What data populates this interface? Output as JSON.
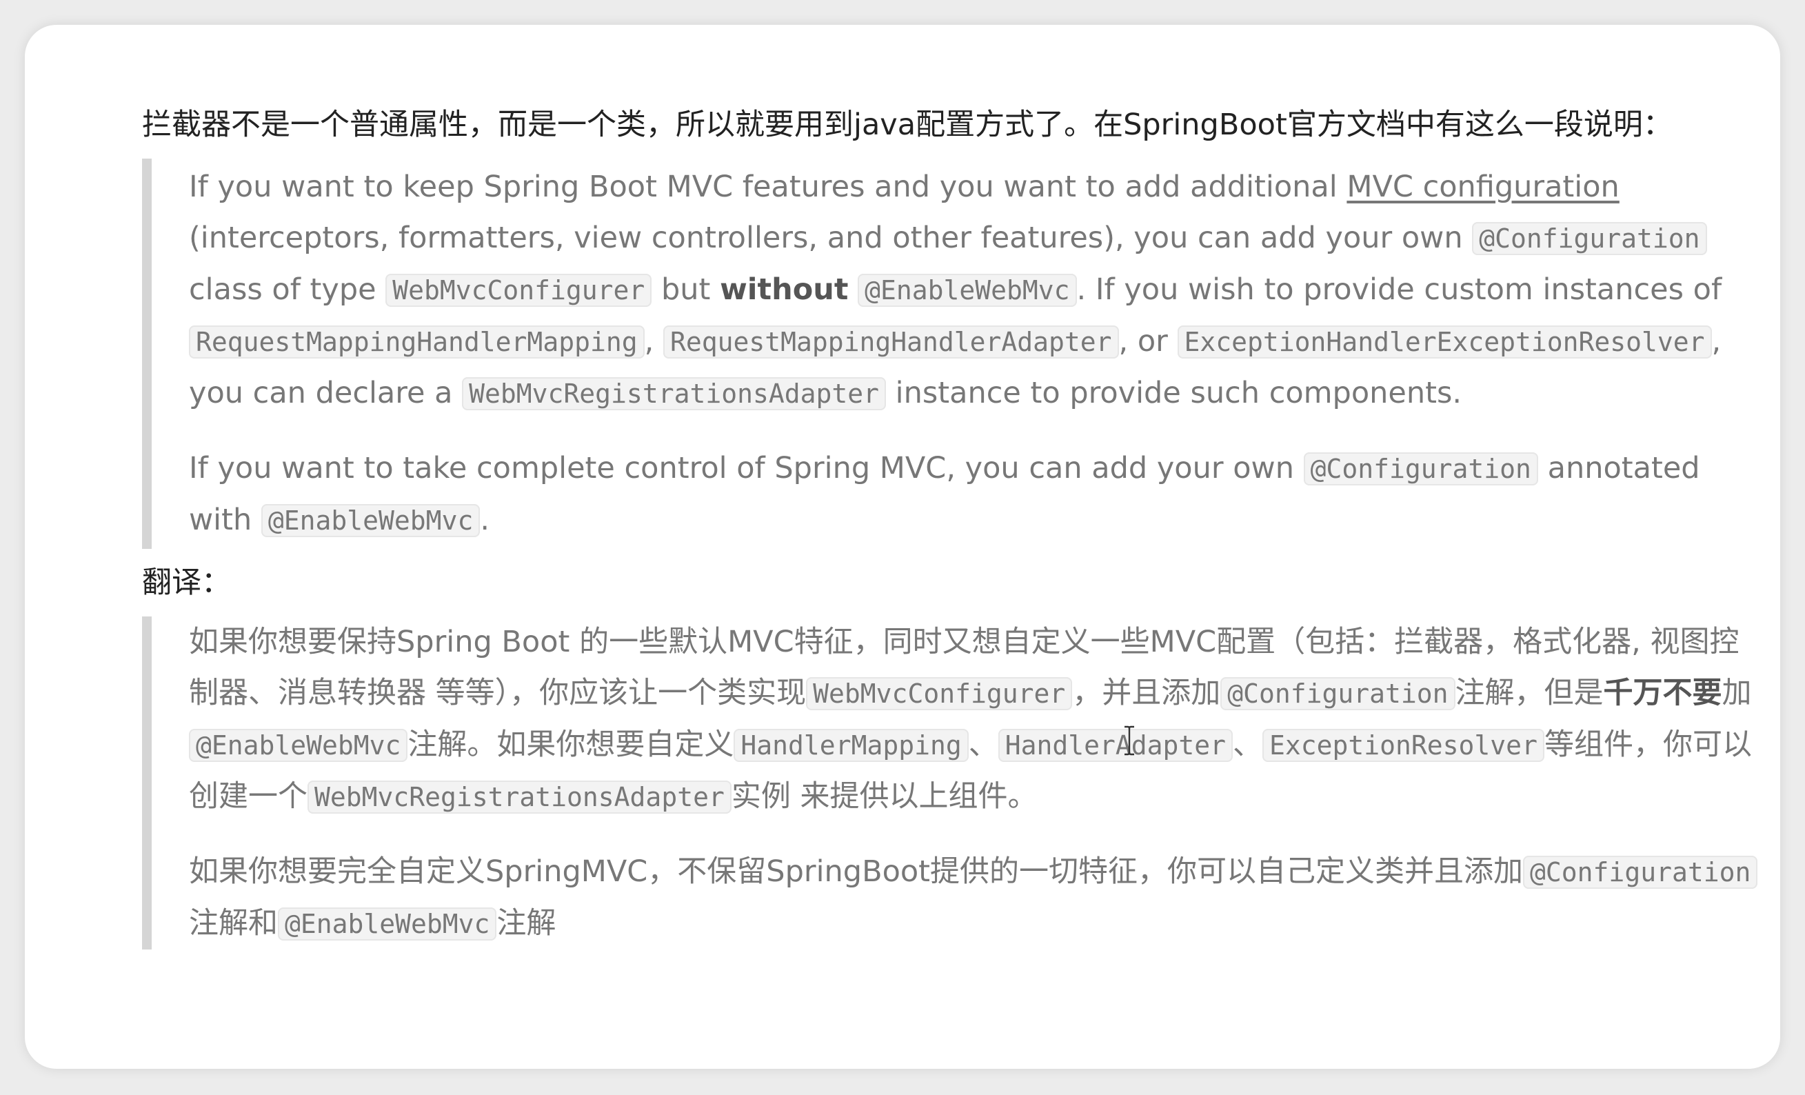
{
  "intro": {
    "text": "拦截器不是一个普通属性，而是一个类，所以就要用到java配置方式了。在SpringBoot官方文档中有这么一段说明："
  },
  "quote_en": {
    "p1": {
      "t1": "If you want to keep Spring Boot MVC features and you want to add additional ",
      "link": "MVC configuration",
      "t2": " (interceptors, formatters, view controllers, and other features), you can add your own ",
      "c1": "@Configuration",
      "t3": " class of type ",
      "c2": "WebMvcConfigurer",
      "t4": " but ",
      "bold": "without",
      "t5": " ",
      "c3": "@EnableWebMvc",
      "t6": ". If you wish to provide custom instances of ",
      "c4": "RequestMappingHandlerMapping",
      "t7": ", ",
      "c5": "RequestMappingHandlerAdapter",
      "t8": ", or ",
      "c6": "ExceptionHandlerExceptionResolver",
      "t9": ", you can declare a ",
      "c7": "WebMvcRegistrationsAdapter",
      "t10": " instance to provide such components."
    },
    "p2": {
      "t1": "If you want to take complete control of Spring MVC, you can add your own ",
      "c1": "@Configuration",
      "t2": " annotated with ",
      "c2": "@EnableWebMvc",
      "t3": "."
    }
  },
  "translate_label": "翻译：",
  "quote_zh": {
    "p1": {
      "t1": "如果你想要保持Spring Boot 的一些默认MVC特征，同时又想自定义一些MVC配置（包括：拦截器，格式化器, 视图控制器、消息转换器 等等），你应该让一个类实现",
      "c1": "WebMvcConfigurer",
      "t2": "，并且添加",
      "c2": "@Configuration",
      "t3": "注解，但是",
      "bold": "千万不要",
      "t4": "加",
      "c3": "@EnableWebMvc",
      "t5": "注解。如果你想要自定义",
      "c4": "HandlerMapping",
      "t6": "、",
      "c5": "HandlerAdapter",
      "t7": "、",
      "c6": "ExceptionResolver",
      "t8": "等组件，你可以创建一个",
      "c7": "WebMvcRegistrationsAdapter",
      "t9": "实例 来提供以上组件。"
    },
    "p2": {
      "t1": "如果你想要完全自定义SpringMVC，不保留SpringBoot提供的一切特征，你可以自己定义类并且添加",
      "c1": "@Configuration",
      "t2": "注解和",
      "c2": "@EnableWebMvc",
      "t3": "注解"
    }
  },
  "icons": {
    "cursor": "text-cursor-icon"
  },
  "colors": {
    "quote_text": "#777777",
    "quote_border": "#d5d5d5",
    "heading_text": "#222222"
  }
}
